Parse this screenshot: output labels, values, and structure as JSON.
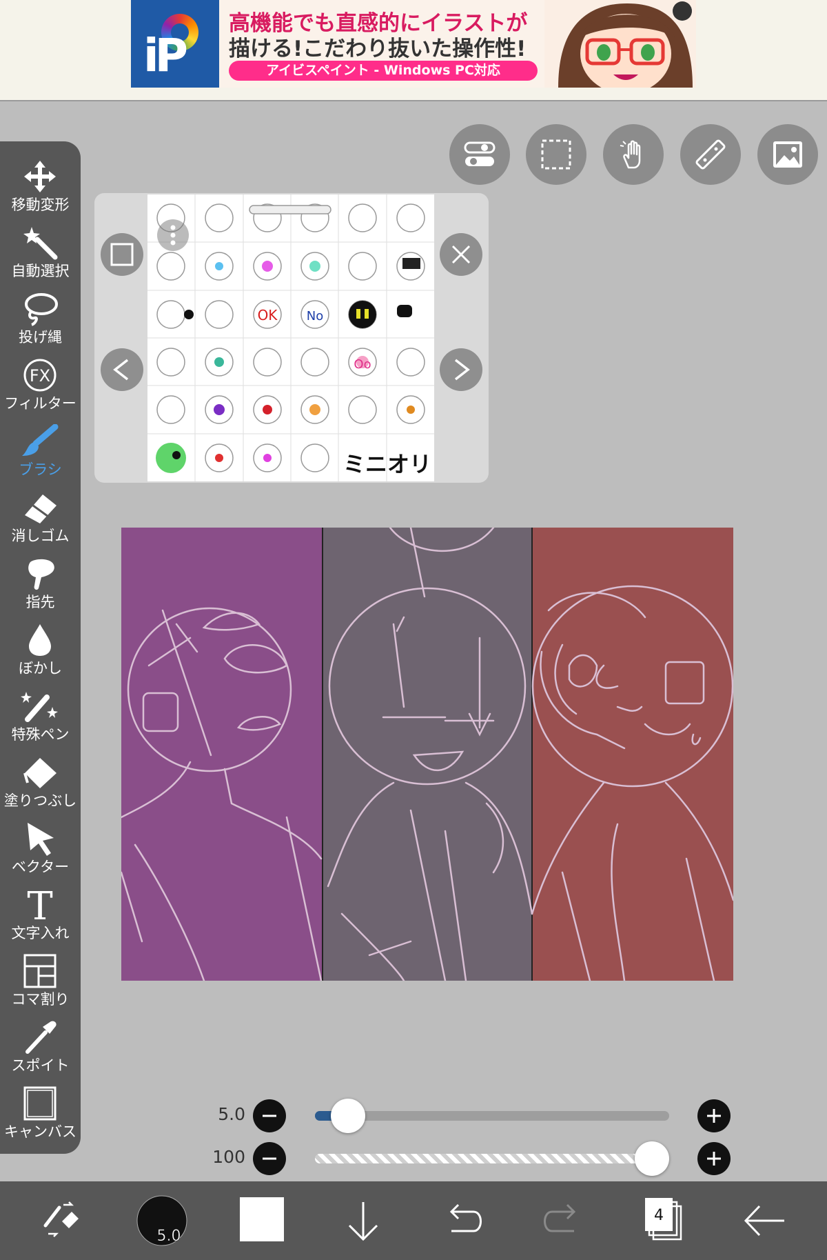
{
  "ad": {
    "logo_text": "iP",
    "line1": "高機能でも直感的にイラストが",
    "line2": "描ける!こだわり抜いた操作性!",
    "pill": "アイビスペイント - Windows PC対応"
  },
  "tools": [
    {
      "label": "移動変形",
      "icon": "move-icon"
    },
    {
      "label": "自動選択",
      "icon": "magic-wand-icon"
    },
    {
      "label": "投げ縄",
      "icon": "lasso-icon"
    },
    {
      "label": "フィルター",
      "icon": "fx-icon",
      "icon_text": "FX"
    },
    {
      "label": "ブラシ",
      "icon": "brush-icon",
      "active": true
    },
    {
      "label": "消しゴム",
      "icon": "eraser-icon"
    },
    {
      "label": "指先",
      "icon": "finger-icon"
    },
    {
      "label": "ぼかし",
      "icon": "blur-drop-icon"
    },
    {
      "label": "特殊ペン",
      "icon": "special-pen-icon"
    },
    {
      "label": "塗りつぶし",
      "icon": "fill-bucket-icon"
    },
    {
      "label": "ベクター",
      "icon": "vector-cursor-icon"
    },
    {
      "label": "文字入れ",
      "icon": "text-icon",
      "icon_text": "T"
    },
    {
      "label": "コマ割り",
      "icon": "frame-divider-icon"
    },
    {
      "label": "スポイト",
      "icon": "eyedropper-icon"
    },
    {
      "label": "キャンバス",
      "icon": "canvas-icon"
    }
  ],
  "top_buttons": [
    "toggle-icon",
    "selection-icon",
    "hand-icon",
    "ruler-icon",
    "image-icon"
  ],
  "reference": {
    "label_ok": "OK",
    "label_no": "No",
    "label_oo": "Oo",
    "label_mini": "ミニオリ"
  },
  "brush": {
    "size_label": "5.0",
    "size_fraction": 0.05,
    "opacity_label": "100",
    "opacity_fraction": 1.0
  },
  "bottom": {
    "brush_size_text": "5.0",
    "layer_count": "4"
  },
  "colors": {
    "panel_left": "#8a4e89",
    "panel_middle": "#6e6470",
    "panel_right": "#9a5050",
    "active_tool": "#4a9fe8",
    "toolbar": "#575757"
  }
}
